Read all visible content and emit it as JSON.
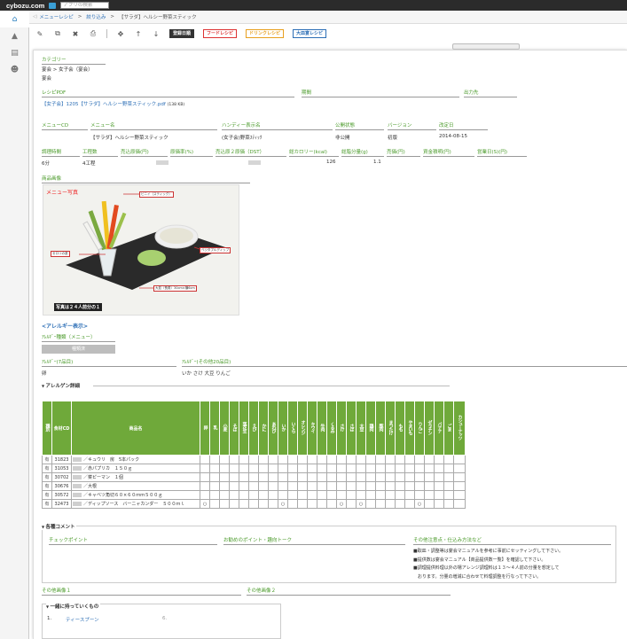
{
  "topbar": {
    "logo": "cybozu.com",
    "search_placeholder": "アプリの検索"
  },
  "breadcrumb": {
    "home": "メニューレシピ",
    "sep": ">",
    "link": "絞り込み",
    "current": "【サラダ】ヘルシー野菜スティック"
  },
  "toolbar": {
    "btn_date": "登録日順",
    "btn_food": "フードレシピ",
    "btn_drink": "ドリンクレシピ",
    "btn_large": "大皿宴レシピ"
  },
  "category": {
    "label": "カテゴリー",
    "path": "宴会 > 女子会（宴会）",
    "value": "宴会"
  },
  "recipe_pdf": {
    "label": "レシピPDF",
    "file": "【女子会】1205【サラダ】ヘルシー野菜スティック.pdf",
    "size": "(138 KB)",
    "period_label": "期間",
    "output_label": "出力先"
  },
  "menu": {
    "cd_label": "メニューCD",
    "name_label": "メニュー名",
    "name_value": "【サラダ】ヘルシー野菜スティック",
    "handy_label": "ハンディー表示名",
    "handy_value": "(女子会)野菜ｽﾃｨｯｸ",
    "public_label": "公開状態",
    "public_value": "非公開",
    "version_label": "バージョン",
    "version_value": "初版",
    "revised_label": "改定日",
    "revised_value": "2014-08-15"
  },
  "metrics": {
    "labels": [
      "調理時間",
      "工程数",
      "売込原価(円)",
      "原価率(%)",
      "売込原２原価（DST）",
      "総カロリー(kcal)",
      "総脂分量(g)",
      "売価(円)",
      "資金積明(円)",
      "営業日(S)(円)"
    ],
    "cook_time": "6分",
    "steps": "4工程",
    "kcal": "126",
    "fat": "1.1"
  },
  "photo": {
    "label": "商品画像",
    "menu_tag": "メニュー写真",
    "ann1": "ビニイ（スティック）",
    "ann2": "セロリの茎",
    "ann3": "ベジタブルディップ",
    "ann4": "大皿（長角）30cm×横6cm",
    "caption": "写真は２４人前分の１"
  },
  "allergy_show": {
    "link": "<アレルギー表示>"
  },
  "allergy_kind": {
    "label": "ｱﾚﾙｷﾞｰ種類（メニュー）",
    "value": "種類済"
  },
  "allergy7": {
    "label": "ｱﾚﾙｷﾞｰ(7品目)",
    "value": "卵"
  },
  "allergy20": {
    "label": "ｱﾚﾙｷﾞｰ(その他20品目)",
    "value": "いか さけ 大豆 りんご"
  },
  "allergy_detail": {
    "title": "アレルゲン詳細",
    "headers": {
      "type": "種別",
      "cd": "食材CD",
      "name": "商品名"
    },
    "allergens": [
      "卵",
      "乳",
      "小麦",
      "そば",
      "落花生",
      "えび",
      "かに",
      "あわび",
      "いか",
      "いくら",
      "オレンジ",
      "キウイ",
      "牛肉",
      "くるみ",
      "さけ",
      "さば",
      "大豆",
      "鶏肉",
      "豚肉",
      "まつたけ",
      "もも",
      "やまいも",
      "りんご",
      "ゼラチン",
      "バナナ",
      "ごま",
      "カシューナッツ"
    ],
    "rows": [
      {
        "type": "有",
        "cd": "31823",
        "name": "／キュウリ　房　5本パック",
        "marks": []
      },
      {
        "type": "有",
        "cd": "31053",
        "name": "／赤パプリカ　１５０ｇ",
        "marks": []
      },
      {
        "type": "有",
        "cd": "30702",
        "name": "／菜ピーマン　１個",
        "marks": []
      },
      {
        "type": "有",
        "cd": "30676",
        "name": "／大根",
        "marks": []
      },
      {
        "type": "有",
        "cd": "30572",
        "name": "／キャベツ角切６０×６０ｍｍ５００ｇ",
        "marks": []
      },
      {
        "type": "有",
        "cd": "32473",
        "name": "／ディップソース　バーニャカンダー　５００ｍｌ",
        "marks": [
          0,
          8,
          14,
          16,
          22
        ]
      }
    ]
  },
  "comments": {
    "title": "各種コメント",
    "col1": "チェックポイント",
    "col2": "お勧めのポイント・趣向トーク",
    "col3": "その他注意点・仕込み方法など",
    "notes": [
      "■取皿・調整等は宴会マニュアルを参考に事前にセッティングして下さい。",
      "■提供数は宴会マニュアル【商品提供数一覧】を確認して下さい。",
      "■調理提供料理以外の場アレンジ調理料は１３～４人前の分量を想定して",
      "　おります。分量の増減に合わせて料理調整を行なって下さい。"
    ]
  },
  "other_img1": {
    "label": "その他画像１"
  },
  "other_img2": {
    "label": "その他画像２"
  },
  "bring": {
    "title": "一緒に持っていくもの",
    "num": "1.",
    "item": "ティースプーン",
    "num2": "6."
  }
}
